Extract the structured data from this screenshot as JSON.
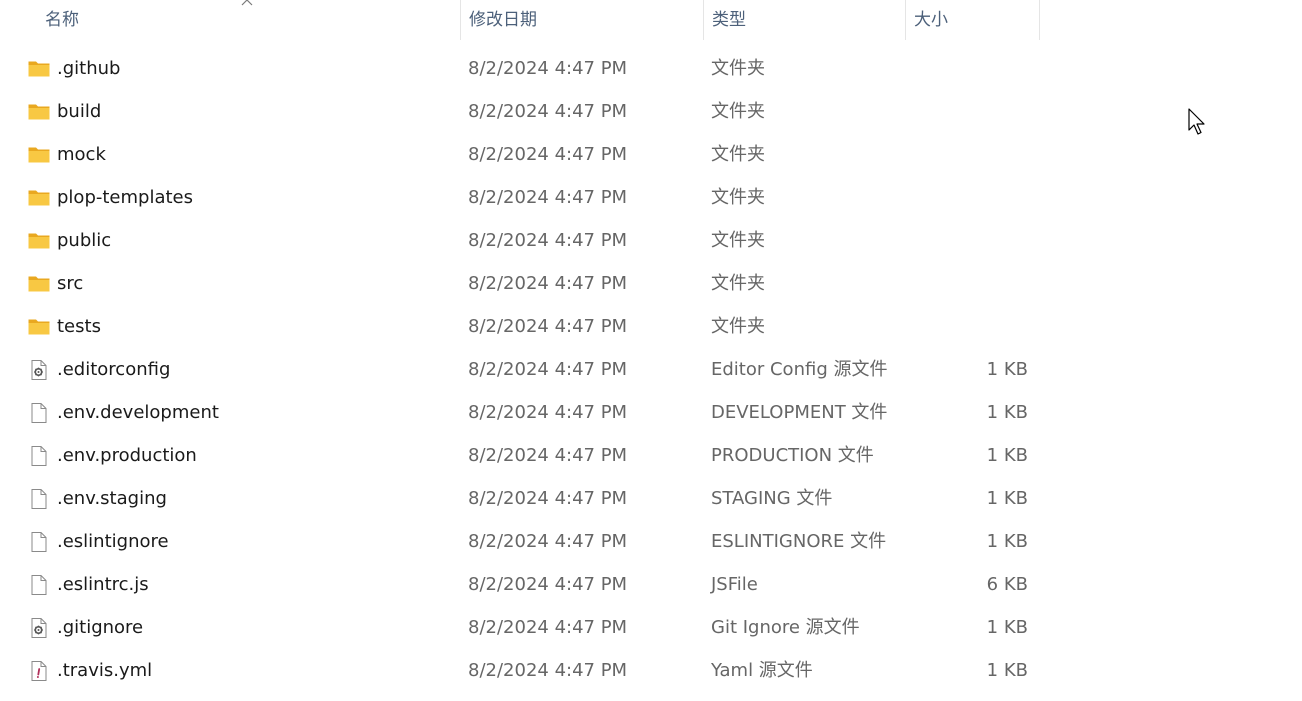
{
  "columns": {
    "name": "名称",
    "date": "修改日期",
    "type": "类型",
    "size": "大小"
  },
  "sort": {
    "column": "name",
    "direction": "ascending",
    "icon": "sort-up-chevron-icon"
  },
  "files": [
    {
      "name": ".github",
      "date": "8/2/2024 4:47 PM",
      "type": "文件夹",
      "size": "",
      "icon": "folder-icon"
    },
    {
      "name": "build",
      "date": "8/2/2024 4:47 PM",
      "type": "文件夹",
      "size": "",
      "icon": "folder-icon"
    },
    {
      "name": "mock",
      "date": "8/2/2024 4:47 PM",
      "type": "文件夹",
      "size": "",
      "icon": "folder-icon"
    },
    {
      "name": "plop-templates",
      "date": "8/2/2024 4:47 PM",
      "type": "文件夹",
      "size": "",
      "icon": "folder-icon"
    },
    {
      "name": "public",
      "date": "8/2/2024 4:47 PM",
      "type": "文件夹",
      "size": "",
      "icon": "folder-icon"
    },
    {
      "name": "src",
      "date": "8/2/2024 4:47 PM",
      "type": "文件夹",
      "size": "",
      "icon": "folder-icon"
    },
    {
      "name": "tests",
      "date": "8/2/2024 4:47 PM",
      "type": "文件夹",
      "size": "",
      "icon": "folder-icon"
    },
    {
      "name": ".editorconfig",
      "date": "8/2/2024 4:47 PM",
      "type": "Editor Config 源文件",
      "size": "1 KB",
      "icon": "config-file-icon"
    },
    {
      "name": ".env.development",
      "date": "8/2/2024 4:47 PM",
      "type": "DEVELOPMENT 文件",
      "size": "1 KB",
      "icon": "file-icon"
    },
    {
      "name": ".env.production",
      "date": "8/2/2024 4:47 PM",
      "type": "PRODUCTION 文件",
      "size": "1 KB",
      "icon": "file-icon"
    },
    {
      "name": ".env.staging",
      "date": "8/2/2024 4:47 PM",
      "type": "STAGING 文件",
      "size": "1 KB",
      "icon": "file-icon"
    },
    {
      "name": ".eslintignore",
      "date": "8/2/2024 4:47 PM",
      "type": "ESLINTIGNORE 文件",
      "size": "1 KB",
      "icon": "file-icon"
    },
    {
      "name": ".eslintrc.js",
      "date": "8/2/2024 4:47 PM",
      "type": "JSFile",
      "size": "6 KB",
      "icon": "file-icon"
    },
    {
      "name": ".gitignore",
      "date": "8/2/2024 4:47 PM",
      "type": "Git Ignore 源文件",
      "size": "1 KB",
      "icon": "config-file-icon"
    },
    {
      "name": ".travis.yml",
      "date": "8/2/2024 4:47 PM",
      "type": "Yaml 源文件",
      "size": "1 KB",
      "icon": "yaml-file-icon"
    }
  ],
  "colors": {
    "header_text": "#4c607a",
    "folder": "#f8c843",
    "folder_dark": "#e9a820",
    "secondary_text": "#666666"
  },
  "cursor_icon": "mouse-pointer-icon"
}
